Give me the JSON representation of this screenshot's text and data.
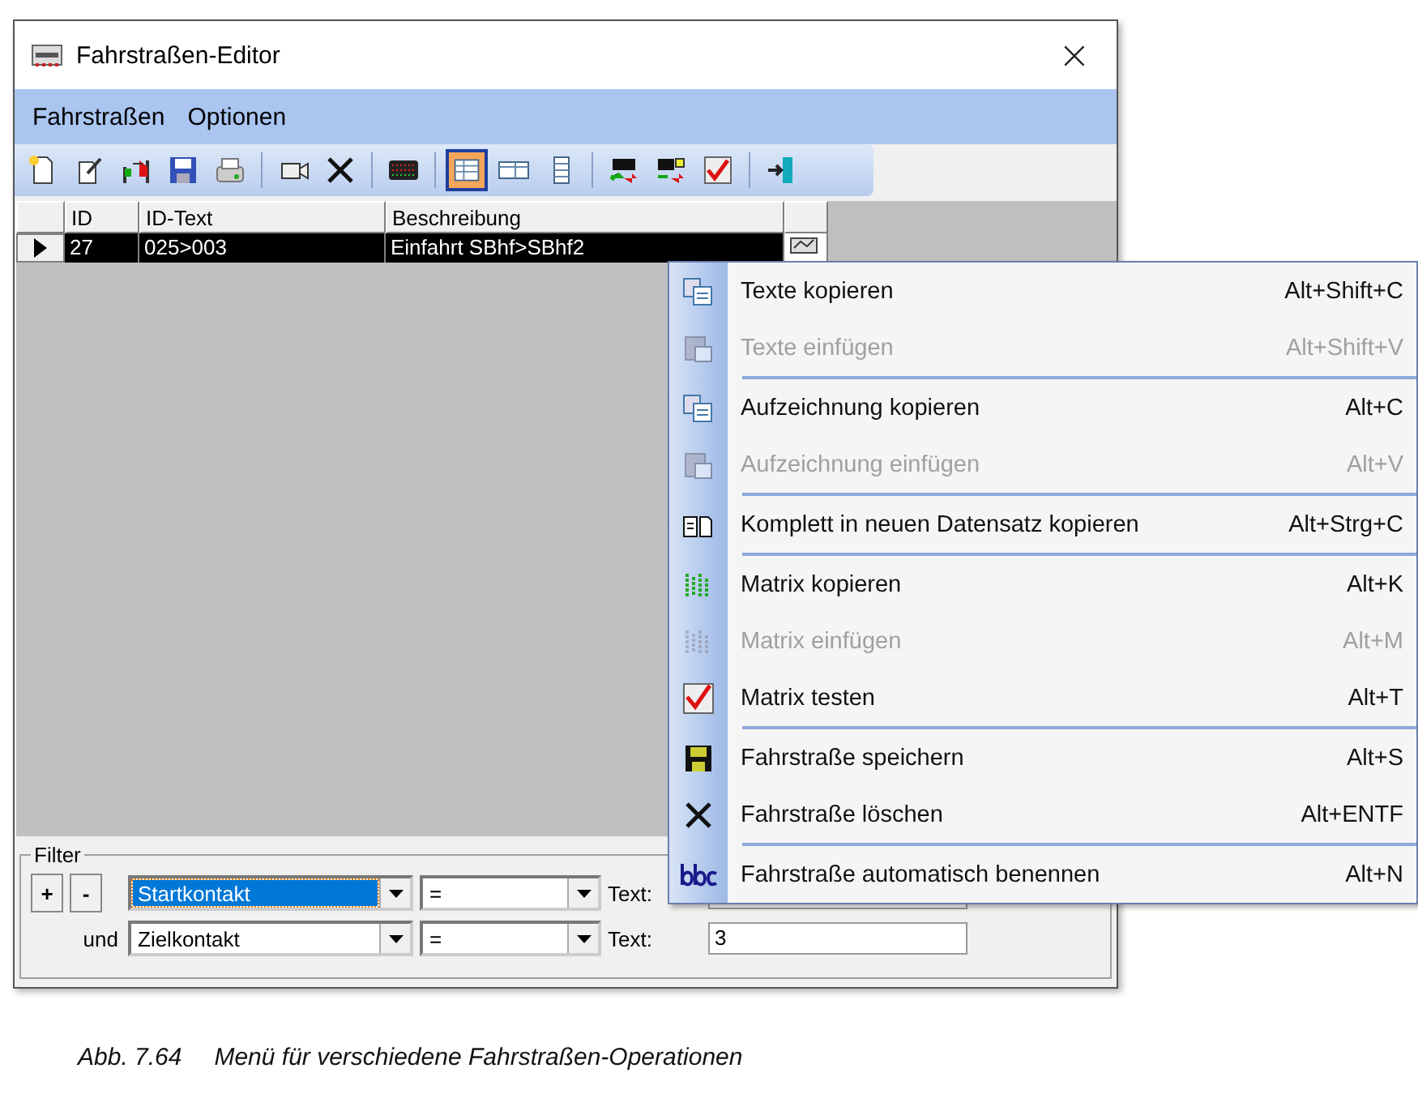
{
  "window": {
    "title": "Fahrstraßen-Editor",
    "close": "×"
  },
  "menu_bar": [
    {
      "label": "Fahrstraßen"
    },
    {
      "label": "Optionen"
    }
  ],
  "toolbar": [
    {
      "kind": "new",
      "selected": false
    },
    {
      "kind": "wand",
      "selected": false
    },
    {
      "kind": "signals",
      "selected": false
    },
    {
      "kind": "save",
      "selected": false
    },
    {
      "kind": "print",
      "selected": false
    },
    {
      "kind": "sep"
    },
    {
      "kind": "camera",
      "selected": false
    },
    {
      "kind": "delete",
      "selected": false
    },
    {
      "kind": "sep"
    },
    {
      "kind": "matrix",
      "selected": false
    },
    {
      "kind": "sep"
    },
    {
      "kind": "table",
      "selected": true
    },
    {
      "kind": "split",
      "selected": false
    },
    {
      "kind": "form",
      "selected": false
    },
    {
      "kind": "sep"
    },
    {
      "kind": "loco",
      "selected": false
    },
    {
      "kind": "loco2",
      "selected": false
    },
    {
      "kind": "check",
      "selected": false
    },
    {
      "kind": "sep"
    },
    {
      "kind": "exit",
      "selected": false
    }
  ],
  "table": {
    "columns": [
      "ID",
      "ID-Text",
      "Beschreibung"
    ],
    "rows": [
      {
        "cells": [
          "27",
          "025>003",
          "Einfahrt SBhf>SBhf2"
        ],
        "selected": true
      }
    ]
  },
  "filter": {
    "title": "Filter",
    "add": "+",
    "remove": "-",
    "rows": [
      {
        "conjunction": "",
        "field": "Startkontakt",
        "field_selected": true,
        "operator": "=",
        "text_label": "Text:",
        "value": ""
      },
      {
        "conjunction": "und",
        "field": "Zielkontakt",
        "field_selected": false,
        "operator": "=",
        "text_label": "Text:",
        "value": "3"
      }
    ]
  },
  "context_menu": [
    {
      "kind": "copy",
      "label": "Texte kopieren",
      "shortcut": "Alt+Shift+C",
      "disabled": false,
      "separator_before": false
    },
    {
      "kind": "paste",
      "label": "Texte einfügen",
      "shortcut": "Alt+Shift+V",
      "disabled": true,
      "separator_before": false
    },
    {
      "kind": "copy",
      "label": "Aufzeichnung kopieren",
      "shortcut": "Alt+C",
      "disabled": false,
      "separator_before": true
    },
    {
      "kind": "paste",
      "label": "Aufzeichnung einfügen",
      "shortcut": "Alt+V",
      "disabled": true,
      "separator_before": false
    },
    {
      "kind": "duplicate",
      "label": "Komplett in neuen Datensatz kopieren",
      "shortcut": "Alt+Strg+C",
      "disabled": false,
      "separator_before": true
    },
    {
      "kind": "matrix",
      "label": "Matrix kopieren",
      "shortcut": "Alt+K",
      "disabled": false,
      "separator_before": true
    },
    {
      "kind": "matrix",
      "label": "Matrix einfügen",
      "shortcut": "Alt+M",
      "disabled": true,
      "separator_before": false
    },
    {
      "kind": "check",
      "label": "Matrix testen",
      "shortcut": "Alt+T",
      "disabled": false,
      "separator_before": false
    },
    {
      "kind": "save",
      "label": "Fahrstraße speichern",
      "shortcut": "Alt+S",
      "disabled": false,
      "separator_before": true
    },
    {
      "kind": "delete",
      "label": "Fahrstraße löschen",
      "shortcut": "Alt+ENTF",
      "disabled": false,
      "separator_before": false
    },
    {
      "kind": "abc",
      "label": "Fahrstraße automatisch benennen",
      "shortcut": "Alt+N",
      "disabled": false,
      "separator_before": true
    }
  ],
  "caption": {
    "number": "Abb. 7.64",
    "text": "Menü für verschiedene Fahrstraßen-Operationen"
  }
}
